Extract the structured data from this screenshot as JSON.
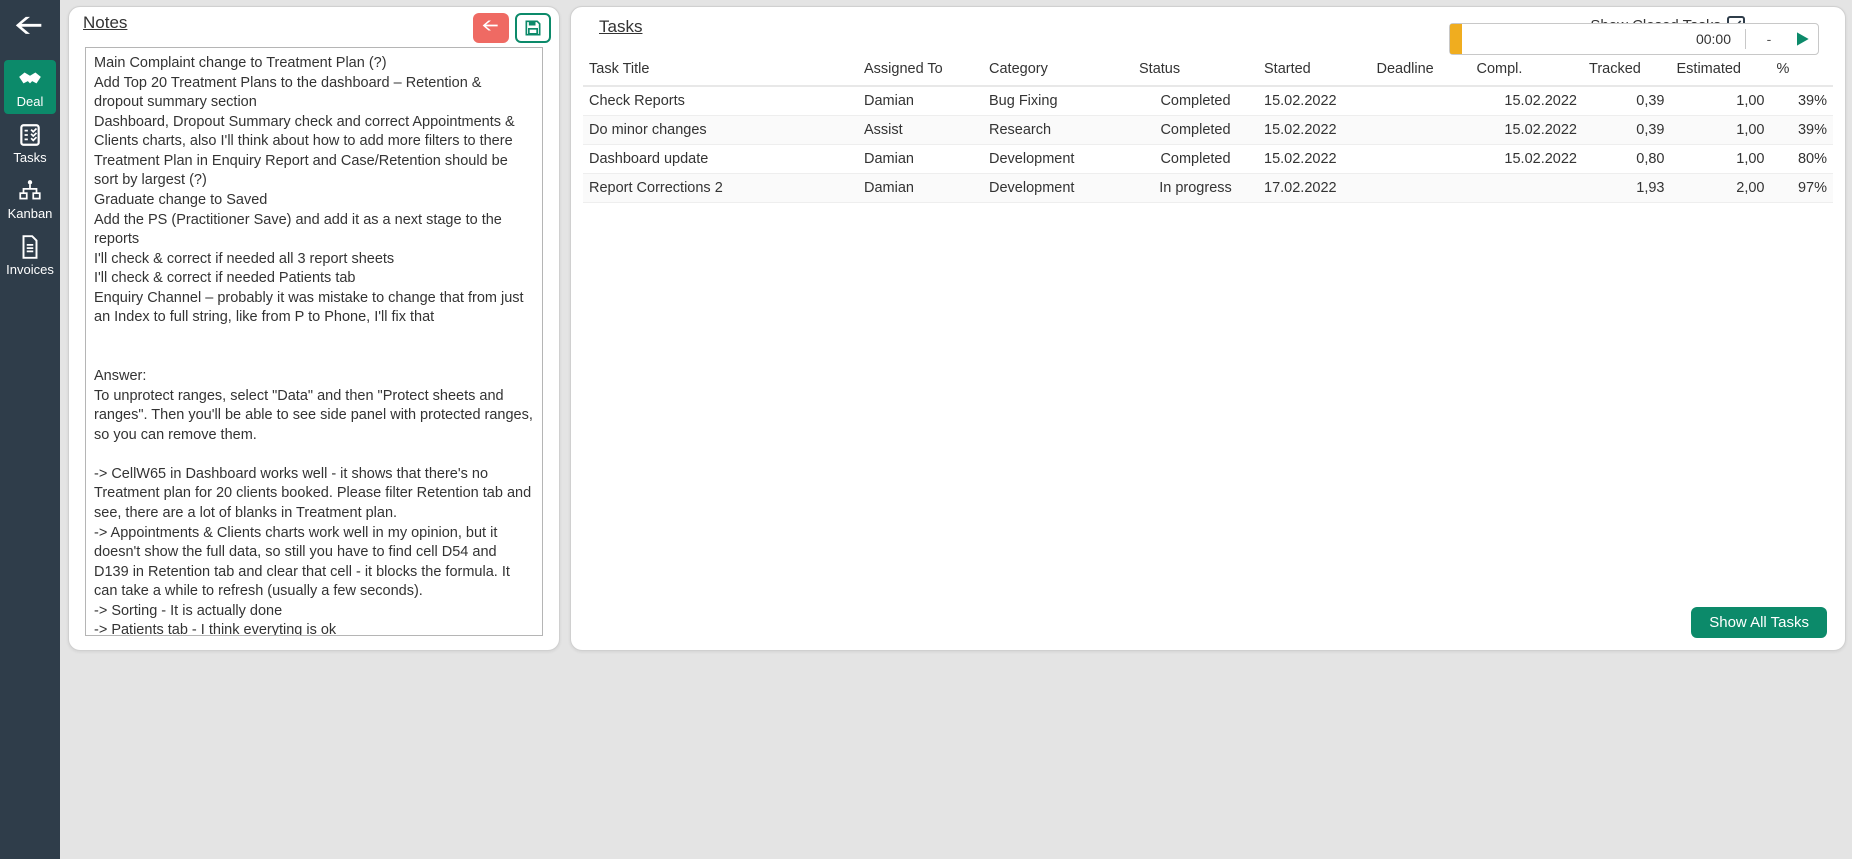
{
  "sidebar": {
    "items": [
      {
        "id": "back",
        "label": ""
      },
      {
        "id": "deal",
        "label": "Deal"
      },
      {
        "id": "tasks",
        "label": "Tasks"
      },
      {
        "id": "kanban",
        "label": "Kanban"
      },
      {
        "id": "invoices",
        "label": "Invoices"
      }
    ]
  },
  "notes": {
    "title": "Notes",
    "text": "Main Complaint change to Treatment Plan (?)\nAdd Top 20 Treatment Plans to the dashboard – Retention & dropout summary section\nDashboard, Dropout Summary check and correct Appointments & Clients charts, also I'll think about how to add more filters to there\nTreatment Plan in Enquiry Report and Case/Retention should be sort by largest (?)\nGraduate change to Saved\nAdd the PS (Practitioner Save) and add it as a next stage to the reports\nI'll check & correct if needed all 3 report sheets\nI'll check & correct if needed Patients tab\nEnquiry Channel – probably it was mistake to change that from just an Index to full string, like from P to Phone, I'll fix that\n\n\nAnswer:\nTo unprotect ranges, select \"Data\" and then \"Protect sheets and ranges\". Then you'll be able to see side panel with protected ranges, so you can remove them.\n\n-> CellW65 in Dashboard works well - it shows that there's no Treatment plan for 20 clients booked. Please filter Retention tab and see, there are a lot of blanks in Treatment plan.\n-> Appointments & Clients charts work well in my opinion, but it doesn't show the full data, so still you have to find cell D54 and D139 in Retention tab and clear that cell - it blocks the formula. It can take a while to refresh (usually a few seconds).\n-> Sorting - It is actually done\n-> Patients tab - I think everyting is ok"
  },
  "tasks": {
    "title": "Tasks",
    "show_closed_label": "Show Closed Tasks",
    "show_closed_checked": true,
    "timer": {
      "time": "00:00",
      "dash": "-"
    },
    "columns": [
      "Task Title",
      "Assigned To",
      "Category",
      "Status",
      "Started",
      "Deadline",
      "Compl.",
      "Tracked",
      "Estimated",
      "%"
    ],
    "rows": [
      {
        "title": "Check Reports",
        "assigned": "Damian",
        "category": "Bug Fixing",
        "status": "Completed",
        "started": "15.02.2022",
        "deadline": "",
        "compl": "15.02.2022",
        "tracked": "0,39",
        "estimated": "1,00",
        "pct": "39%"
      },
      {
        "title": "Do minor changes",
        "assigned": "Assist",
        "category": "Research",
        "status": "Completed",
        "started": "15.02.2022",
        "deadline": "",
        "compl": "15.02.2022",
        "tracked": "0,39",
        "estimated": "1,00",
        "pct": "39%"
      },
      {
        "title": "Dashboard update",
        "assigned": "Damian",
        "category": "Development",
        "status": "Completed",
        "started": "15.02.2022",
        "deadline": "",
        "compl": "15.02.2022",
        "tracked": "0,80",
        "estimated": "1,00",
        "pct": "80%"
      },
      {
        "title": "Report Corrections 2",
        "assigned": "Damian",
        "category": "Development",
        "status": "In progress",
        "started": "17.02.2022",
        "deadline": "",
        "compl": "",
        "tracked": "1,93",
        "estimated": "2,00",
        "pct": "97%"
      }
    ],
    "show_all_label": "Show All Tasks"
  }
}
